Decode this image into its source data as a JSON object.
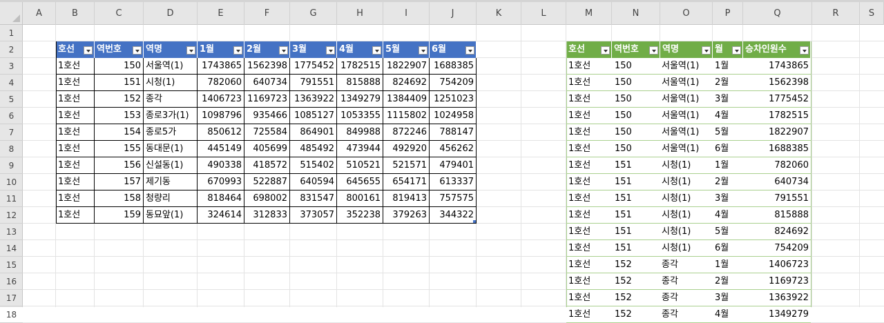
{
  "columns": [
    "A",
    "B",
    "C",
    "D",
    "E",
    "F",
    "G",
    "H",
    "I",
    "J",
    "K",
    "L",
    "M",
    "N",
    "O",
    "P",
    "Q",
    "R",
    "S"
  ],
  "rows": [
    "1",
    "2",
    "3",
    "4",
    "5",
    "6",
    "7",
    "8",
    "9",
    "10",
    "11",
    "12",
    "13",
    "14",
    "15",
    "16",
    "17",
    "18"
  ],
  "table1": {
    "headers": [
      "호선",
      "역번호",
      "역명",
      "1월",
      "2월",
      "3월",
      "4월",
      "5월",
      "6월"
    ],
    "rows": [
      [
        "1호선",
        "150",
        "서울역(1)",
        "1743865",
        "1562398",
        "1775452",
        "1782515",
        "1822907",
        "1688385"
      ],
      [
        "1호선",
        "151",
        "시청(1)",
        "782060",
        "640734",
        "791551",
        "815888",
        "824692",
        "754209"
      ],
      [
        "1호선",
        "152",
        "종각",
        "1406723",
        "1169723",
        "1363922",
        "1349279",
        "1384409",
        "1251023"
      ],
      [
        "1호선",
        "153",
        "종로3가(1)",
        "1098796",
        "935466",
        "1085127",
        "1053355",
        "1115802",
        "1024958"
      ],
      [
        "1호선",
        "154",
        "종로5가",
        "850612",
        "725584",
        "864901",
        "849988",
        "872246",
        "788147"
      ],
      [
        "1호선",
        "155",
        "동대문(1)",
        "445149",
        "405699",
        "485492",
        "473944",
        "492920",
        "456262"
      ],
      [
        "1호선",
        "156",
        "신설동(1)",
        "490338",
        "418572",
        "515402",
        "510521",
        "521571",
        "479401"
      ],
      [
        "1호선",
        "157",
        "제기동",
        "670993",
        "522887",
        "640594",
        "645655",
        "654171",
        "613337"
      ],
      [
        "1호선",
        "158",
        "청량리",
        "818464",
        "698002",
        "831547",
        "800161",
        "819413",
        "757575"
      ],
      [
        "1호선",
        "159",
        "동묘앞(1)",
        "324614",
        "312833",
        "373057",
        "352238",
        "379263",
        "344322"
      ]
    ]
  },
  "table2": {
    "headers": [
      "호선",
      "역번호",
      "역명",
      "월",
      "승차인원수"
    ],
    "rows": [
      [
        "1호선",
        "150",
        "서울역(1)",
        "1월",
        "1743865"
      ],
      [
        "1호선",
        "150",
        "서울역(1)",
        "2월",
        "1562398"
      ],
      [
        "1호선",
        "150",
        "서울역(1)",
        "3월",
        "1775452"
      ],
      [
        "1호선",
        "150",
        "서울역(1)",
        "4월",
        "1782515"
      ],
      [
        "1호선",
        "150",
        "서울역(1)",
        "5월",
        "1822907"
      ],
      [
        "1호선",
        "150",
        "서울역(1)",
        "6월",
        "1688385"
      ],
      [
        "1호선",
        "151",
        "시청(1)",
        "1월",
        "782060"
      ],
      [
        "1호선",
        "151",
        "시청(1)",
        "2월",
        "640734"
      ],
      [
        "1호선",
        "151",
        "시청(1)",
        "3월",
        "791551"
      ],
      [
        "1호선",
        "151",
        "시청(1)",
        "4월",
        "815888"
      ],
      [
        "1호선",
        "151",
        "시청(1)",
        "5월",
        "824692"
      ],
      [
        "1호선",
        "151",
        "시청(1)",
        "6월",
        "754209"
      ],
      [
        "1호선",
        "152",
        "종각",
        "1월",
        "1406723"
      ],
      [
        "1호선",
        "152",
        "종각",
        "2월",
        "1169723"
      ],
      [
        "1호선",
        "152",
        "종각",
        "3월",
        "1363922"
      ],
      [
        "1호선",
        "152",
        "종각",
        "4월",
        "1349279"
      ]
    ]
  },
  "colors": {
    "table1_header": "#4472c4",
    "table2_header": "#70ad47",
    "table2_border": "#a9d08e",
    "header_bg": "#e6e6e6"
  }
}
